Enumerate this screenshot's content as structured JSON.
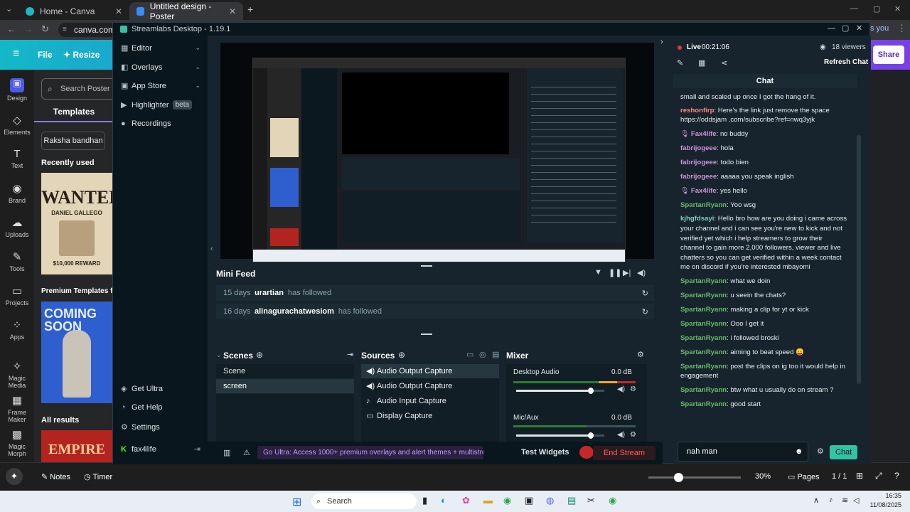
{
  "chrome": {
    "tabs": [
      {
        "title": "Home - Canva"
      },
      {
        "title": "Untitled design - Poster"
      }
    ],
    "url": "canva.com/",
    "share_label": "Share",
    "you_label": "s you"
  },
  "canva": {
    "menu": {
      "file": "File",
      "resize": "Resize"
    },
    "rail": [
      "Design",
      "Elements",
      "Text",
      "Brand",
      "Uploads",
      "Tools",
      "Projects",
      "Apps",
      "Magic Media",
      "Frame Maker",
      "Magic Morph"
    ],
    "search_placeholder": "Search Poster te",
    "templates_tab": "Templates",
    "chip": "Raksha bandhan",
    "recently_used": "Recently used",
    "wanted_title": "WANTED",
    "wanted_name": "DANIEL GALLEGO",
    "wanted_reward": "$10,000 REWARD",
    "premium_title": "Premium Templates fo",
    "coming_soon": "COMING SOON",
    "all_results": "All results",
    "empire": "EMPIRE",
    "bottom": {
      "notes": "Notes",
      "timer": "Timer",
      "zoom": "30%",
      "pages": "Pages",
      "page_count": "1 / 1"
    }
  },
  "streamlabs": {
    "title": "Streamlabs Desktop - 1.19.1",
    "nav": [
      {
        "label": "Editor",
        "icon": "editor-icon"
      },
      {
        "label": "Overlays",
        "icon": "overlays-icon"
      },
      {
        "label": "App Store",
        "icon": "store-icon"
      },
      {
        "label": "Highlighter",
        "icon": "highlighter-icon",
        "badge": "beta"
      },
      {
        "label": "Recordings",
        "icon": "recordings-icon"
      }
    ],
    "bottom_nav": [
      "Get Ultra",
      "Get Help",
      "Settings"
    ],
    "account": "fax4life",
    "mini_feed": {
      "title": "Mini Feed",
      "rows": [
        {
          "time": "15 days",
          "user": "urartian",
          "action": "has followed"
        },
        {
          "time": "16 days",
          "user": "alinagurachatwesiom",
          "action": "has followed"
        }
      ]
    },
    "scenes": {
      "title": "Scenes",
      "items": [
        "Scene",
        "screen"
      ]
    },
    "sources": {
      "title": "Sources",
      "items": [
        "Audio Output Capture",
        "Audio Output Capture",
        "Audio Input Capture",
        "Display Capture"
      ]
    },
    "mixer": {
      "title": "Mixer",
      "channels": [
        {
          "name": "Desktop Audio",
          "db": "0.0 dB",
          "level": 0.85
        },
        {
          "name": "Mic/Aux",
          "db": "0.0 dB",
          "level": 0.85
        }
      ]
    },
    "status": {
      "ultra_text": "Go Ultra: Access 1000+ premium overlays and alert themes + multistream.",
      "test_widgets": "Test Widgets",
      "end_stream": "End Stream"
    },
    "live": {
      "label": "Live",
      "time": "00:21:06",
      "viewers": "18 viewers",
      "refresh": "Refresh Chat"
    },
    "chat": {
      "title": "Chat",
      "top_line": "small and scaled up once I got the hang of it.",
      "messages": [
        {
          "user": "reshonfirp",
          "color": "red",
          "text": "Here's the link just remove the space https://oddsjam .com/subscribe?ref=nwq3yjk"
        },
        {
          "user": "Fax4life",
          "color": "pink",
          "text": "no buddy",
          "mic": true
        },
        {
          "user": "fabrijogeee",
          "color": "pink",
          "text": "hola"
        },
        {
          "user": "fabrijogeee",
          "color": "pink",
          "text": "todo bien"
        },
        {
          "user": "fabrijogeee",
          "color": "pink",
          "text": "aaaaa you speak inglish"
        },
        {
          "user": "Fax4life",
          "color": "pink",
          "text": "yes hello",
          "mic": true
        },
        {
          "user": "SpartanRyann",
          "color": "green",
          "text": "Yoo wsg"
        },
        {
          "user": "kjhgfdsayi",
          "color": "teal",
          "text": "Hello bro how are you doing i came across your channel and i can see you're new to kick and not verified yet which i help streamers to grow their channel to gain more 2,000 followers, viewer and live chatters so you can get verified within a week contact me on discord if you're interested mbayomi"
        },
        {
          "user": "SpartanRyann",
          "color": "green",
          "text": "what we doin"
        },
        {
          "user": "SpartanRyann",
          "color": "green",
          "text": "u seein the chats?"
        },
        {
          "user": "SpartanRyann",
          "color": "green",
          "text": "making a clip for yt or kick"
        },
        {
          "user": "SpartanRyann",
          "color": "green",
          "text": "Ooo I get it"
        },
        {
          "user": "SpartanRyann",
          "color": "green",
          "text": "i followed broski"
        },
        {
          "user": "SpartanRyann",
          "color": "green",
          "text": "aiming to beat speed 😛"
        },
        {
          "user": "SpartanRyann",
          "color": "green",
          "text": "post the clips on ig too it would help in engagement"
        },
        {
          "user": "SpartanRyann",
          "color": "green",
          "text": "btw what u usually do on stream ?"
        },
        {
          "user": "SpartanRyann",
          "color": "green",
          "text": "good start"
        }
      ],
      "input_value": "nah man",
      "send_label": "Chat"
    }
  },
  "taskbar": {
    "search": "Search",
    "time": "16:35",
    "date": "11/08/2025"
  }
}
